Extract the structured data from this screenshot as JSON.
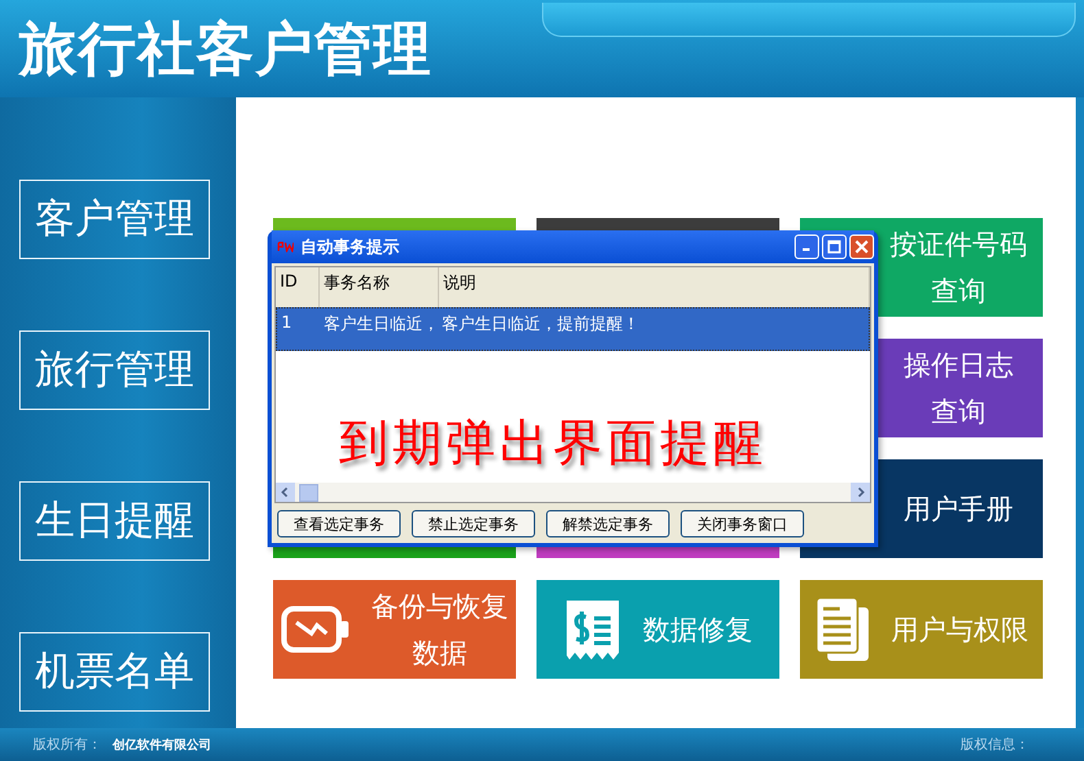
{
  "header": {
    "title": "旅行社客户管理"
  },
  "sidebar": {
    "items": [
      {
        "label": "客户管理"
      },
      {
        "label": "旅行管理"
      },
      {
        "label": "生日提醒"
      },
      {
        "label": "机票名单"
      }
    ]
  },
  "tiles": [
    {
      "kind": "plain",
      "color": "#6cba1e"
    },
    {
      "kind": "plain",
      "color": "#3c3c3c"
    },
    {
      "kind": "text",
      "color": "#0fa864",
      "lines": [
        "按证件号码",
        "查询"
      ]
    },
    {
      "kind": "covered"
    },
    {
      "kind": "covered"
    },
    {
      "kind": "text",
      "color": "#6a3cb8",
      "lines": [
        "操作日志",
        "查询"
      ]
    },
    {
      "kind": "plain",
      "color": "#1aa21a"
    },
    {
      "kind": "plain",
      "color": "#c03cc0"
    },
    {
      "kind": "text",
      "color": "#083663",
      "lines": [
        "用户手册"
      ]
    },
    {
      "kind": "battery",
      "color": "#dd5a2a",
      "lines": [
        "备份与恢复",
        "数据"
      ]
    },
    {
      "kind": "receipt",
      "color": "#0aa0ae",
      "lines": [
        "数据修复"
      ]
    },
    {
      "kind": "document",
      "color": "#a8901a",
      "lines": [
        "用户与权限"
      ]
    }
  ],
  "dialog": {
    "title": "自动事务提示",
    "columns": [
      "ID",
      "事务名称",
      "说明"
    ],
    "rows": [
      {
        "selected": true,
        "cells": [
          "1",
          "客户生日临近，",
          "客户生日临近，提前提醒！"
        ]
      }
    ],
    "buttons": [
      "查看选定事务",
      "禁止选定事务",
      "解禁选定事务",
      "关闭事务窗口"
    ]
  },
  "overlay_caption": "到期弹出界面提醒",
  "footer": {
    "left_label": "版权所有：",
    "company": "创亿软件有限公司",
    "right_label": "版权信息："
  }
}
